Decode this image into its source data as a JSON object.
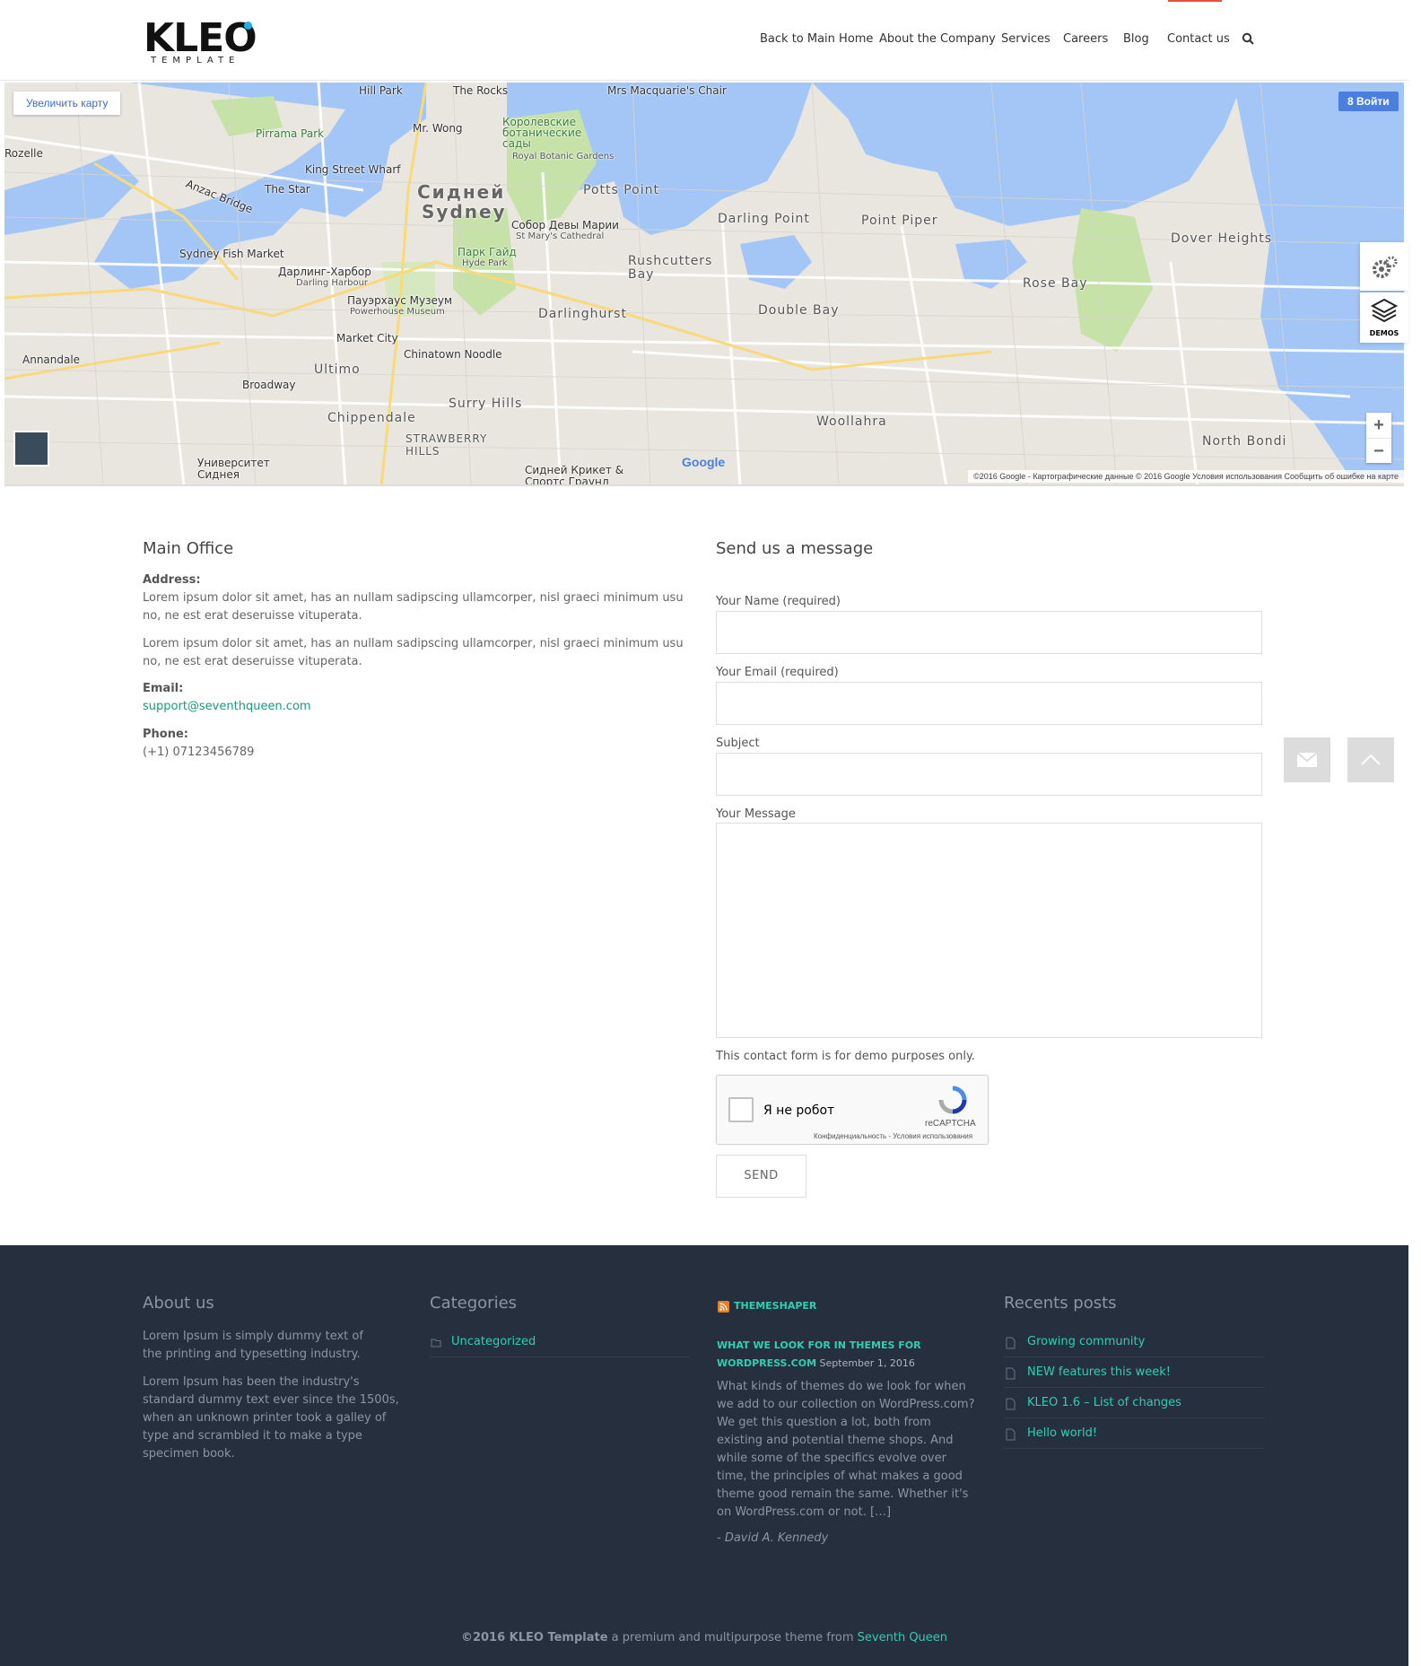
{
  "header": {
    "logo_text": "KLEO",
    "logo_sub": "TEMPLATE",
    "nav": [
      {
        "label": "Back to Main Home"
      },
      {
        "label": "About the Company"
      },
      {
        "label": "Services"
      },
      {
        "label": "Careers"
      },
      {
        "label": "Blog"
      },
      {
        "label": "Contact us"
      }
    ],
    "active_color": "#e74c3c"
  },
  "map": {
    "enlarge_label": "Увеличить карту",
    "login_label": "8 Войти",
    "zoom_in": "+",
    "zoom_out": "−",
    "google": "Google",
    "footer_text": "©2016 Google - Картографические данные © 2016 Google   Условия использования   Сообщить об ошибке на карте",
    "labels": {
      "hill_park": "Hill Park",
      "the_rocks": "The Rocks",
      "macquarie": "Mrs Macquarie's Chair",
      "pirrama": "Pirrama Park",
      "mr_wong": "Mr. Wong",
      "botanic": "Королевские ботанические сады",
      "botanic_en": "Royal Botanic Gardens",
      "rozelle": "Rozelle",
      "king_st": "King Street Wharf",
      "the_star": "The Star",
      "sydney_ru": "Сидней",
      "sydney_en": "Sydney",
      "potts": "Potts Point",
      "cathedral_ru": "Собор Девы Марии",
      "cathedral_en": "St Mary's Cathedral",
      "darling_pt": "Darling Point",
      "point_piper": "Point Piper",
      "dover": "Dover Heights",
      "anzac": "Anzac Bridge",
      "hyde_ru": "Парк Гайд",
      "hyde_en": "Hyde Park",
      "fish_market": "Sydney Fish Market",
      "darling_h_ru": "Дарлинг-Харбор",
      "darling_h_en": "Darling Harbour",
      "rushcutters": "Rushcutters Bay",
      "rose_bay": "Rose Bay",
      "powerhouse_ru": "Пауэрхаус Музеум",
      "powerhouse_en": "Powerhouse Museum",
      "darlinghurst": "Darlinghurst",
      "double_bay": "Double Bay",
      "annandale": "Annandale",
      "market_city": "Market City",
      "chinatown": "Chinatown Noodle",
      "ultimo": "Ultimo",
      "broadway": "Broadway",
      "surry": "Surry Hills",
      "chippendale": "Chippendale",
      "strawberry": "STRAWBERRY HILLS",
      "woollahra": "Woollahra",
      "north_bondi": "North Bondi",
      "uni_ru": "Университет Сиднея",
      "cricket_ru": "Сидней Крикет & Спортс Граунд Траст"
    }
  },
  "side": {
    "demos_label": "DEMOS"
  },
  "office": {
    "title": "Main Office",
    "address_label": "Address:",
    "address_1": "Lorem ipsum dolor sit amet, has an nullam sadipscing ullamcorper, nisl graeci minimum usu no, ne est erat deseruisse vituperata.",
    "address_2": "Lorem ipsum dolor sit amet, has an nullam sadipscing ullamcorper, nisl graeci minimum usu no, ne est erat deseruisse vituperata.",
    "email_label": "Email:",
    "email": "support@seventhqueen.com",
    "phone_label": "Phone:",
    "phone": "(+1) 07123456789"
  },
  "form": {
    "title": "Send us a message",
    "name_label": "Your Name (required)",
    "email_label": "Your Email (required)",
    "subject_label": "Subject",
    "message_label": "Your Message",
    "note": "This contact form is for demo purposes only.",
    "captcha_text": "Я не робот",
    "captcha_brand": "reCAPTCHA",
    "captcha_links": "Конфиденциальность - Условия использования",
    "send_label": "SEND",
    "accent": "#1a9a7a"
  },
  "footer": {
    "about_title": "About us",
    "about_1": "Lorem Ipsum is simply dummy text of the printing and typesetting industry.",
    "about_2": "Lorem Ipsum has been the industry's standard dummy text ever since the 1500s, when an unknown printer took a galley of type and scrambled it to make a type specimen book.",
    "categories_title": "Categories",
    "category_1": "Uncategorized",
    "rss_title": "THEMESHAPER",
    "rss_post_title": "WHAT WE LOOK FOR IN THEMES FOR WORDPRESS.COM",
    "rss_date": "September 1, 2016",
    "rss_body": "What kinds of themes do we look for when we add to our collection on WordPress.com? We get this question a lot, both from existing and potential theme shops. And while some of the specifics evolve over time, the principles of what makes a good theme good remain the same. Whether it's on WordPress.com or not. […]",
    "rss_author": "- David A. Kennedy",
    "recent_title": "Recents posts",
    "recent": [
      {
        "label": "Growing community"
      },
      {
        "label": "NEW features this week!"
      },
      {
        "label": "KLEO 1.6 – List of changes"
      },
      {
        "label": "Hello world!"
      }
    ],
    "copy_brand": "©2016 KLEO Template",
    "copy_mid": " a premium and multipurpose theme from ",
    "copy_link": "Seventh Queen",
    "bg_color": "#262f3e",
    "link_color": "#2fcfb0"
  }
}
